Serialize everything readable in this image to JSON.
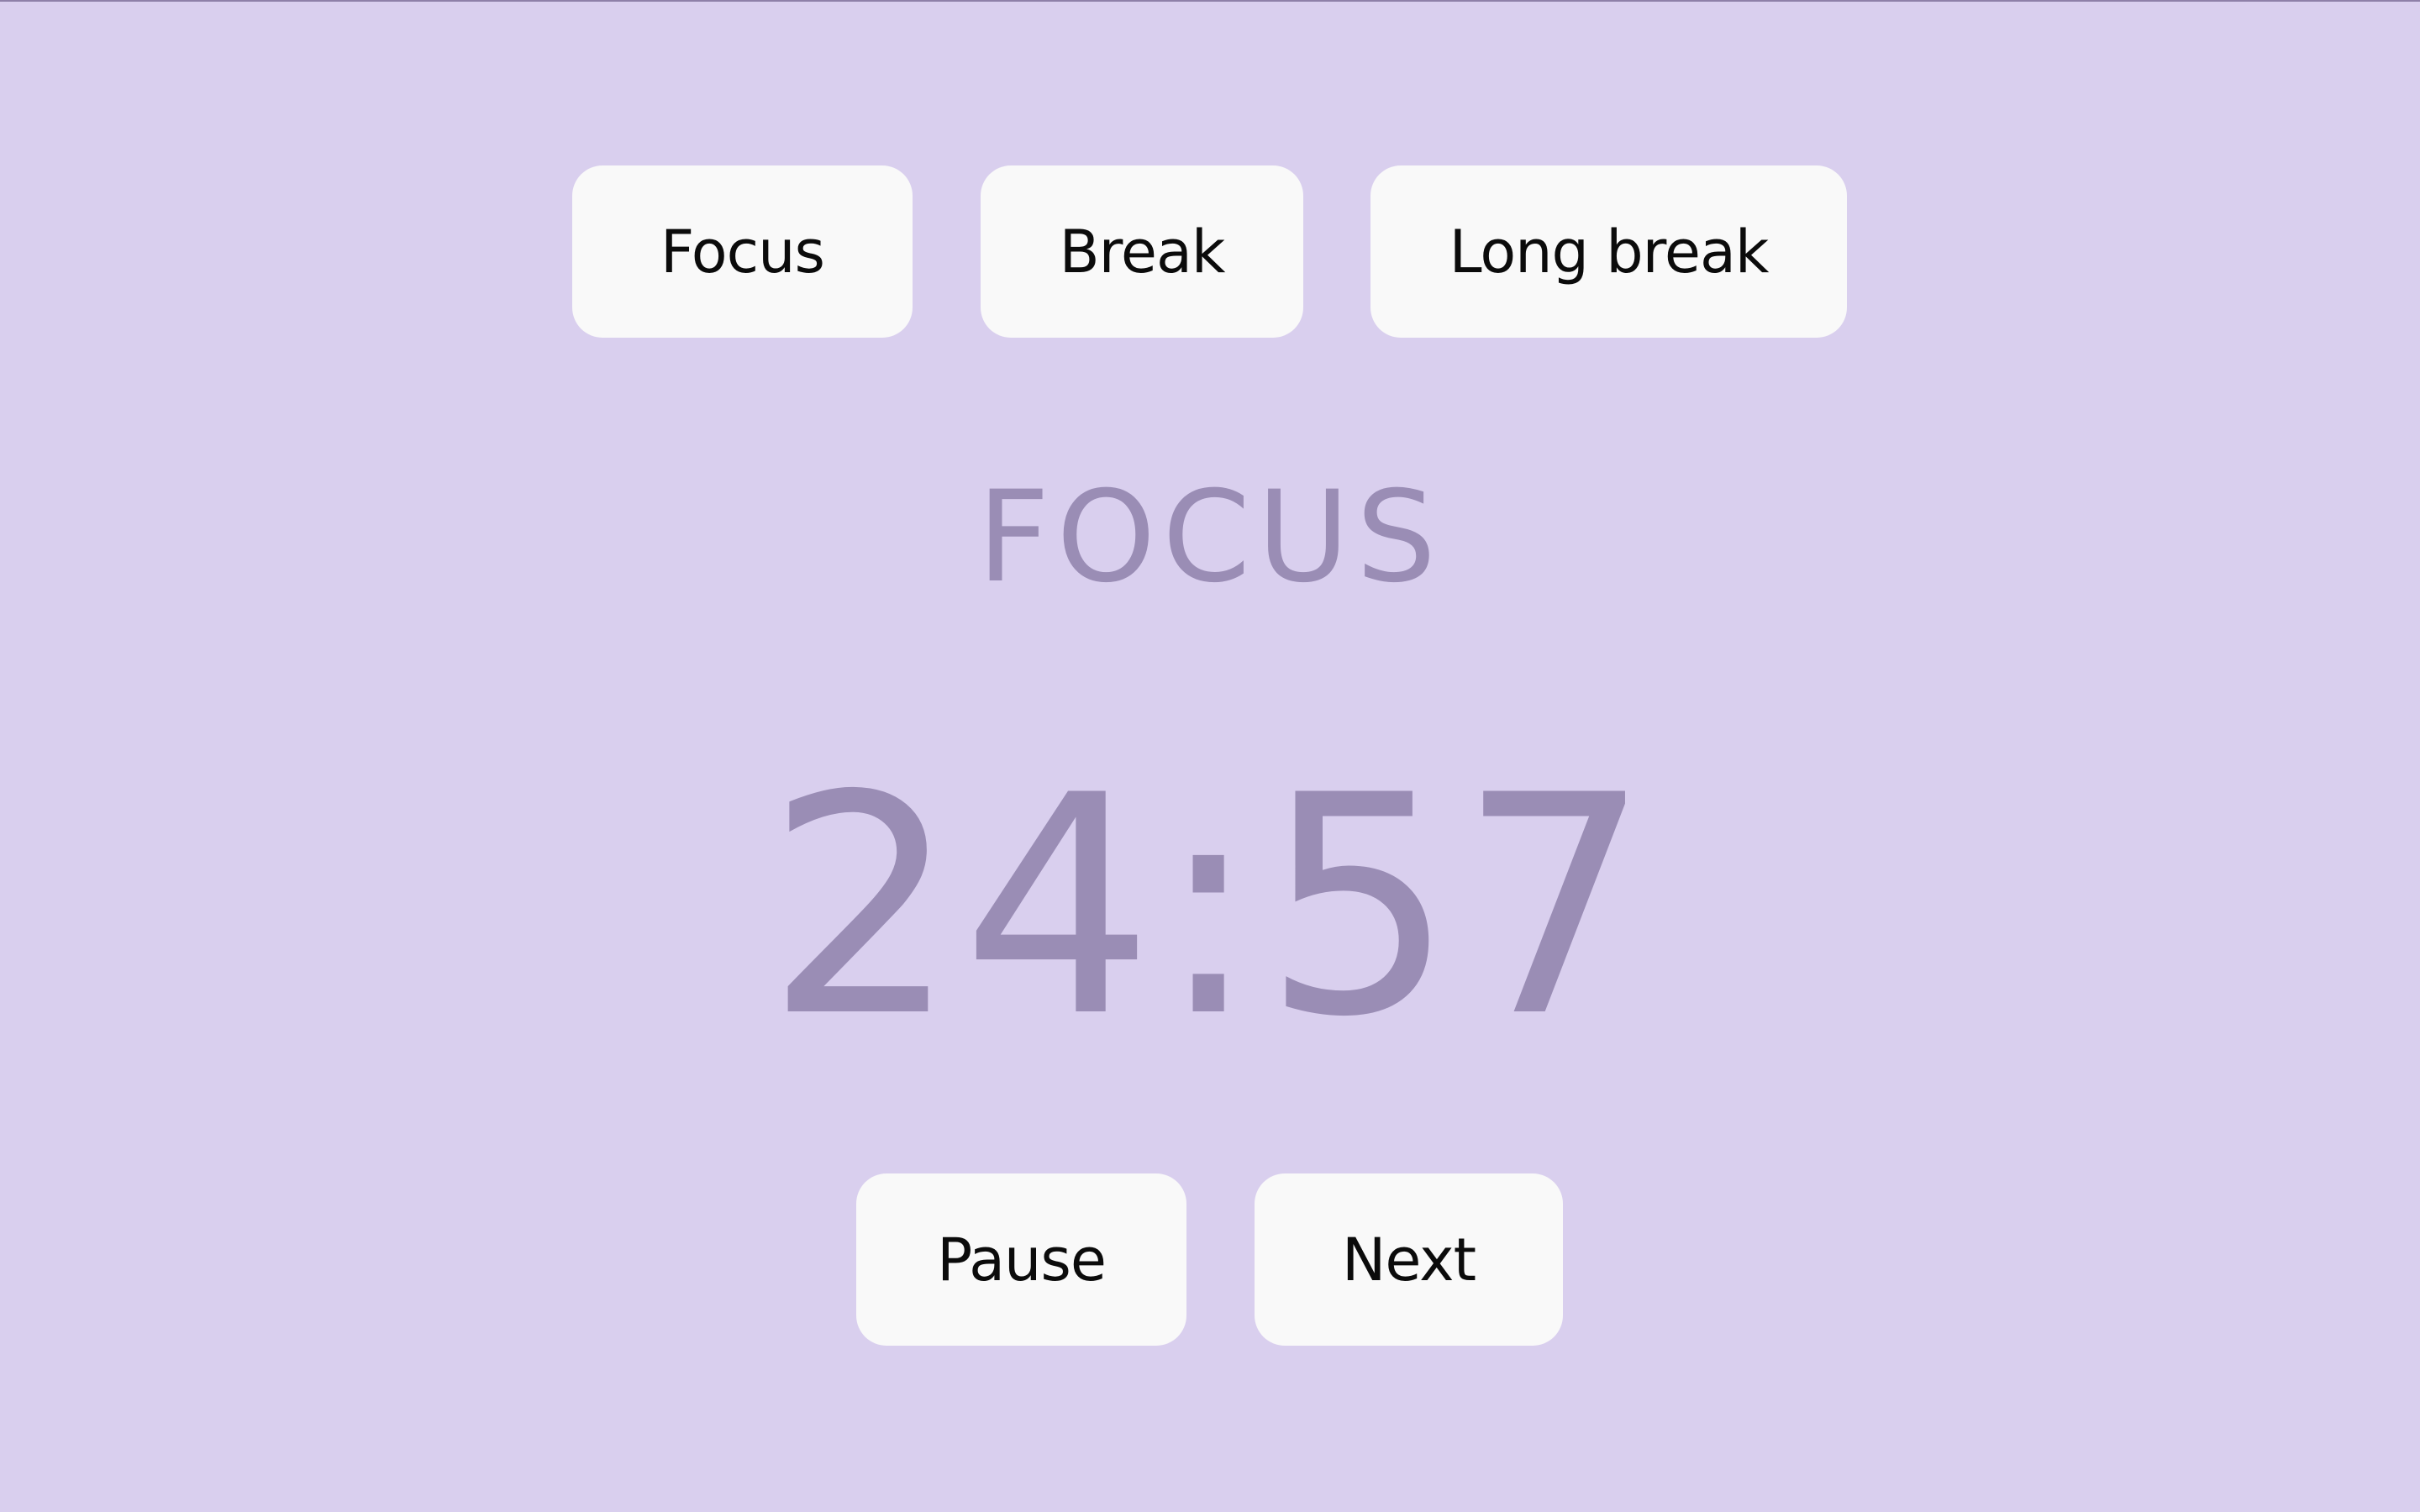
{
  "modes": {
    "focus_label": "Focus",
    "break_label": "Break",
    "long_break_label": "Long break"
  },
  "current": {
    "mode_title": "FOCUS",
    "time_remaining": "24:57"
  },
  "controls": {
    "pause_label": "Pause",
    "next_label": "Next"
  },
  "colors": {
    "background": "#d9cfee",
    "accent_text": "#9a8db5",
    "button_bg": "#f9f9f9",
    "button_text": "#0b0b0b"
  }
}
